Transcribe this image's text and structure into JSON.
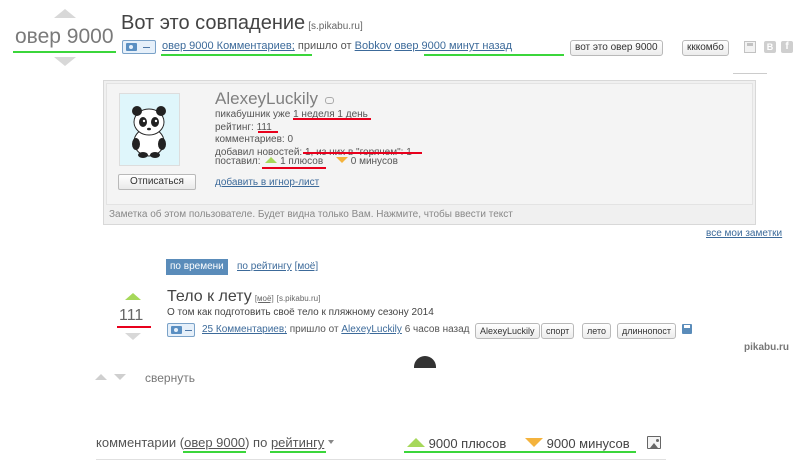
{
  "post": {
    "rating": "овер 9000",
    "title": "Вот это совпадение",
    "source": "[s.pikabu.ru]",
    "comments_link": "овер 9000 Комментариев;",
    "from_text": "пришло от",
    "author": "Bobkov",
    "time": "овер 9000 минут назад",
    "tags": [
      "вот это овер 9000",
      "кккомбо"
    ],
    "icons": [
      "save-icon",
      "vk-icon",
      "facebook-icon"
    ]
  },
  "profile": {
    "username": "AlexeyLuckily",
    "lines": [
      {
        "label": "пикабушник уже ",
        "value": "1 неделя 1 день"
      },
      {
        "label": "рейтинг: ",
        "value": "111"
      },
      {
        "label": "комментариев: ",
        "value": "0"
      },
      {
        "label": "добавил новостей: ",
        "value": "1, из них в \"горячем\": 1"
      }
    ],
    "gave_label": "поставил:",
    "plus_text": "1 плюсов",
    "minus_text": "0 минусов",
    "unsubscribe": "Отписаться",
    "ignore_link": "добавить в игнор-лист",
    "note_placeholder": "Заметка об этом пользователе. Будет видна только Вам. Нажмите, чтобы ввести текст",
    "all_notes": "все мои заметки"
  },
  "sort": {
    "active": "по времени",
    "rating": "по рейтингу",
    "mine": "[моё]"
  },
  "inner_post": {
    "rating": "111",
    "title": "Тело к лету",
    "mine": "[моё]",
    "source": "[s.pikabu.ru]",
    "description": "О том как подготовить своё тело к пляжному сезону 2014",
    "comments_link": "25 Комментариев;",
    "from_text": "пришло от",
    "author": "AlexeyLuckily",
    "time": "6 часов назад",
    "tags": [
      "AlexeyLuckily",
      "спорт",
      "лето",
      "длиннопост"
    ]
  },
  "collapse": "свернуть",
  "watermark": "pikabu.ru",
  "footer": {
    "comments_label": "комментарии (",
    "comments_count": "овер 9000",
    "comments_close": ")",
    "by": "по",
    "sort": "рейтингу",
    "plus": "9000 плюсов",
    "minus": "9000 минусов"
  },
  "colors": {
    "accent_red": "#e8001c",
    "accent_green": "#3bd63b",
    "link": "#3c6a9a"
  }
}
